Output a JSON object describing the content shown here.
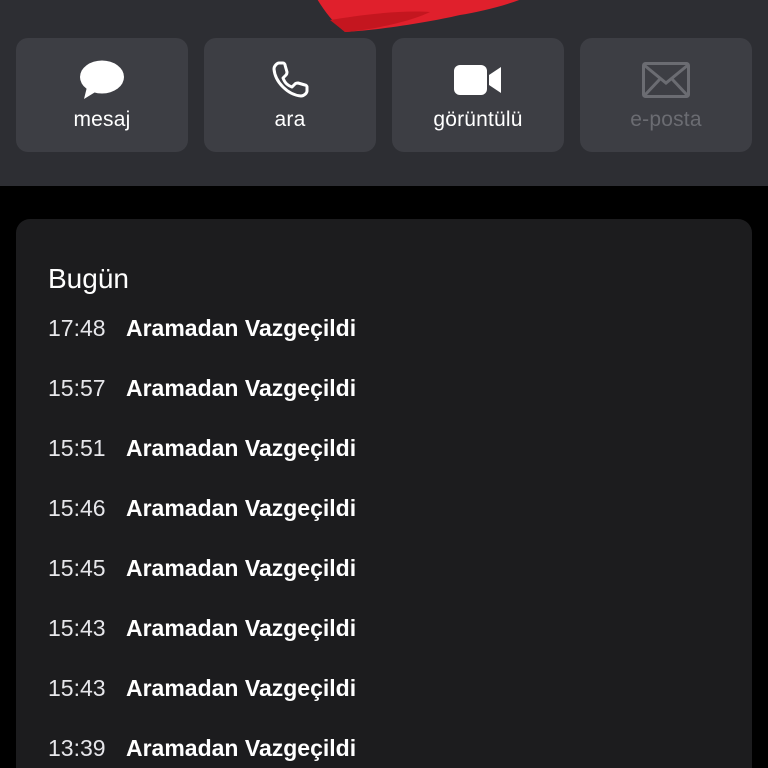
{
  "header": {
    "art_color": "#e0202c",
    "actions": [
      {
        "label": "mesaj",
        "icon": "message-bubble-icon",
        "enabled": true
      },
      {
        "label": "ara",
        "icon": "phone-icon",
        "enabled": true
      },
      {
        "label": "görüntülü",
        "icon": "video-camera-icon",
        "enabled": true
      },
      {
        "label": "e-posta",
        "icon": "envelope-icon",
        "enabled": false
      }
    ]
  },
  "history": {
    "title": "Bugün",
    "calls": [
      {
        "time": "17:48",
        "status": "Aramadan Vazgeçildi"
      },
      {
        "time": "15:57",
        "status": "Aramadan Vazgeçildi"
      },
      {
        "time": "15:51",
        "status": "Aramadan Vazgeçildi"
      },
      {
        "time": "15:46",
        "status": "Aramadan Vazgeçildi"
      },
      {
        "time": "15:45",
        "status": "Aramadan Vazgeçildi"
      },
      {
        "time": "15:43",
        "status": "Aramadan Vazgeçildi"
      },
      {
        "time": "15:43",
        "status": "Aramadan Vazgeçildi"
      },
      {
        "time": "13:39",
        "status": "Aramadan Vazgeçildi"
      }
    ]
  },
  "colors": {
    "header_bg": "#2d2e33",
    "button_bg": "#3d3e44",
    "card_bg": "#1c1c1e",
    "disabled_text": "#6b6c72"
  }
}
